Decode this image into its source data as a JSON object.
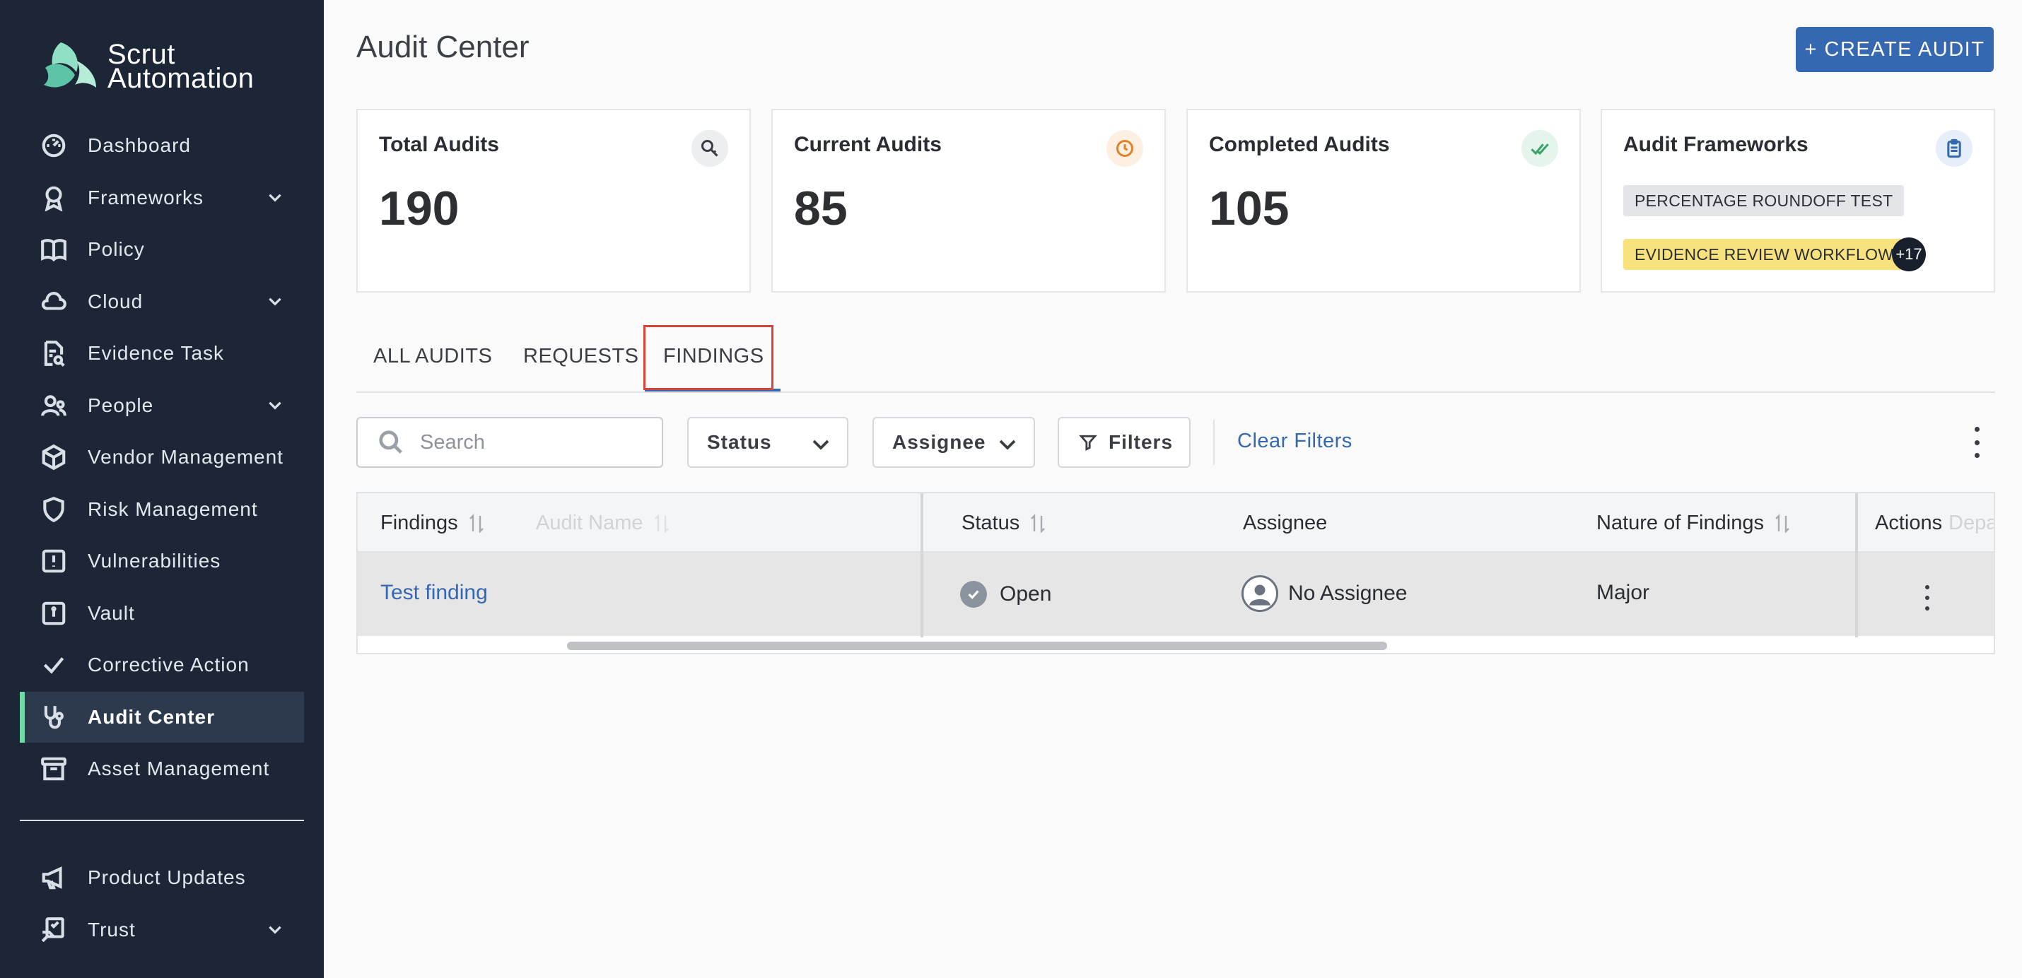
{
  "app": {
    "brand_line1": "Scrut",
    "brand_line2": "Automation"
  },
  "sidebar": {
    "items": [
      {
        "label": "Dashboard",
        "icon": "dashboard-icon"
      },
      {
        "label": "Frameworks",
        "icon": "award-icon",
        "expandable": true
      },
      {
        "label": "Policy",
        "icon": "book-icon"
      },
      {
        "label": "Cloud",
        "icon": "cloud-icon",
        "expandable": true
      },
      {
        "label": "Evidence Task",
        "icon": "evidence-icon"
      },
      {
        "label": "People",
        "icon": "people-icon",
        "expandable": true
      },
      {
        "label": "Vendor Management",
        "icon": "box-icon"
      },
      {
        "label": "Risk Management",
        "icon": "shield-icon"
      },
      {
        "label": "Vulnerabilities",
        "icon": "alert-square-icon"
      },
      {
        "label": "Vault",
        "icon": "vault-icon"
      },
      {
        "label": "Corrective Action",
        "icon": "check-icon"
      },
      {
        "label": "Audit Center",
        "icon": "stethoscope-icon",
        "active": true
      },
      {
        "label": "Asset Management",
        "icon": "archive-icon"
      }
    ],
    "bottom_items": [
      {
        "label": "Product Updates",
        "icon": "megaphone-icon"
      },
      {
        "label": "Trust",
        "icon": "trust-icon",
        "expandable": true
      }
    ],
    "accent_color": "#73d6a8"
  },
  "header": {
    "title": "Audit Center",
    "create_button": "+ CREATE AUDIT"
  },
  "cards": {
    "total": {
      "title": "Total Audits",
      "value": "190",
      "icon": "search-key-icon"
    },
    "current": {
      "title": "Current Audits",
      "value": "85",
      "icon": "clock-icon"
    },
    "completed": {
      "title": "Completed Audits",
      "value": "105",
      "icon": "double-check-icon"
    },
    "frameworks": {
      "title": "Audit Frameworks",
      "icon": "clipboard-icon",
      "tags": [
        "PERCENTAGE ROUNDOFF TEST",
        "EVIDENCE REVIEW WORKFLOW"
      ],
      "more": "+17"
    }
  },
  "tabs": [
    "ALL AUDITS",
    "REQUESTS",
    "FINDINGS"
  ],
  "active_tab": "FINDINGS",
  "toolbar": {
    "search_placeholder": "Search",
    "status_label": "Status",
    "assignee_label": "Assignee",
    "filters_label": "Filters",
    "clear_filters": "Clear Filters"
  },
  "table": {
    "columns": [
      "Findings",
      "Audit Name",
      "Status",
      "Assignee",
      "Nature of Findings",
      "Actions",
      "Depa"
    ],
    "rows": [
      {
        "finding": "Test finding",
        "audit_name": "",
        "status": "Open",
        "assignee": "No Assignee",
        "nature": "Major"
      }
    ]
  },
  "colors": {
    "primary": "#3568b0",
    "sidebar_bg": "#1c2637",
    "highlight_box": "#d9443a"
  }
}
